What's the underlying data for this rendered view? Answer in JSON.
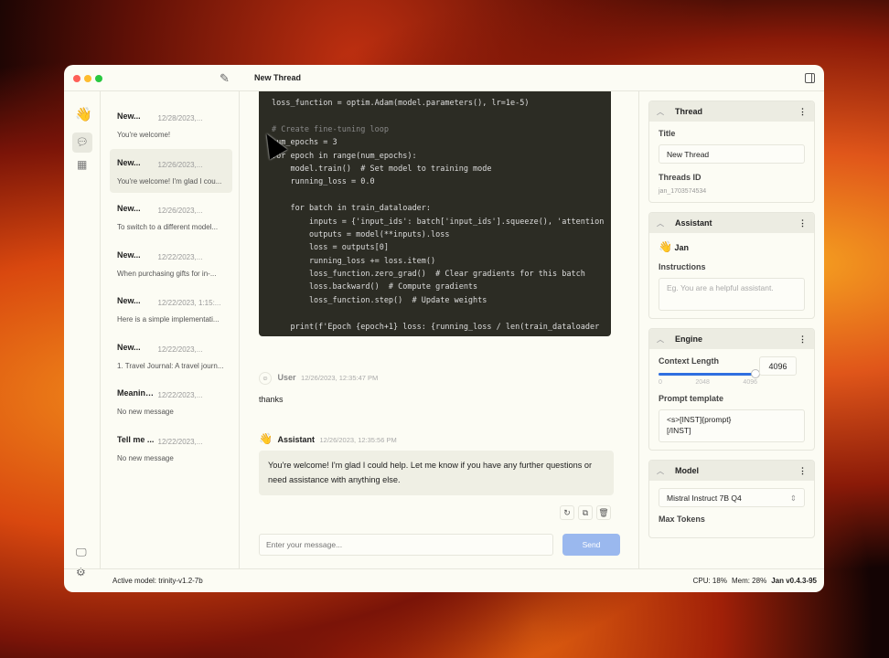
{
  "window": {
    "title": "New Thread"
  },
  "threads": [
    {
      "title": "New...",
      "date": "12/28/2023,...",
      "preview": "You're welcome!"
    },
    {
      "title": "New...",
      "date": "12/26/2023,...",
      "preview": "You're welcome! I'm glad I cou..."
    },
    {
      "title": "New...",
      "date": "12/26/2023,...",
      "preview": "To switch to a different model..."
    },
    {
      "title": "New...",
      "date": "12/22/2023,...",
      "preview": "When purchasing gifts for in-..."
    },
    {
      "title": "New...",
      "date": "12/22/2023, 1:15:...",
      "preview": "Here is a simple implementati..."
    },
    {
      "title": "New...",
      "date": "12/22/2023,...",
      "preview": "1. Travel Journal: A travel journ..."
    },
    {
      "title": "Meaning ...",
      "date": "12/22/2023,...",
      "preview": "No new message"
    },
    {
      "title": "Tell me ...",
      "date": "12/22/2023,...",
      "preview": "No new message"
    }
  ],
  "code_lines": [
    "loss_function = optim.Adam(model.parameters(), lr=1e-5)",
    "",
    "# Create fine-tuning loop",
    "num_epochs = 3",
    "for epoch in range(num_epochs):",
    "    model.train()  # Set model to training mode",
    "    running_loss = 0.0",
    "",
    "    for batch in train_dataloader:",
    "        inputs = {'input_ids': batch['input_ids'].squeeze(), 'attention",
    "        outputs = model(**inputs).loss",
    "        loss = outputs[0]",
    "        running_loss += loss.item()",
    "        loss_function.zero_grad()  # Clear gradients for this batch",
    "        loss.backward()  # Compute gradients",
    "        loss_function.step()  # Update weights",
    "",
    "    print(f'Epoch {epoch+1} loss: {running_loss / len(train_dataloader"
  ],
  "messages": [
    {
      "role": "User",
      "time": "12/26/2023, 12:35:47 PM",
      "text": "thanks"
    },
    {
      "role": "Assistant",
      "time": "12/26/2023, 12:35:56 PM",
      "text": "You're welcome! I'm glad I could help. Let me know if you have any further questions or need assistance with anything else."
    }
  ],
  "composer": {
    "placeholder": "Enter your message...",
    "send": "Send"
  },
  "panel": {
    "thread": {
      "header": "Thread",
      "title_label": "Title",
      "title_value": "New Thread",
      "id_label": "Threads ID",
      "id_value": "jan_1703574534"
    },
    "assistant": {
      "header": "Assistant",
      "name": "Jan",
      "instructions_label": "Instructions",
      "instructions_placeholder": "Eg. You are a helpful assistant."
    },
    "engine": {
      "header": "Engine",
      "context_label": "Context Length",
      "context_value": "4096",
      "context_fraction": 1.0,
      "ticks": [
        "0",
        "2048",
        "4096"
      ],
      "prompt_label": "Prompt template",
      "prompt_value": "<s>[INST]{prompt}\n[/INST]"
    },
    "model": {
      "header": "Model",
      "selected": "Mistral Instruct 7B Q4",
      "max_tokens_label": "Max Tokens"
    }
  },
  "status": {
    "active_model": "Active model: trinity-v1.2-7b",
    "cpu": "CPU: 18%",
    "mem": "Mem: 28%",
    "version": "Jan v0.4.3-95"
  },
  "colors": {
    "accent": "#2f6fe0",
    "send": "#9ab8ee"
  }
}
